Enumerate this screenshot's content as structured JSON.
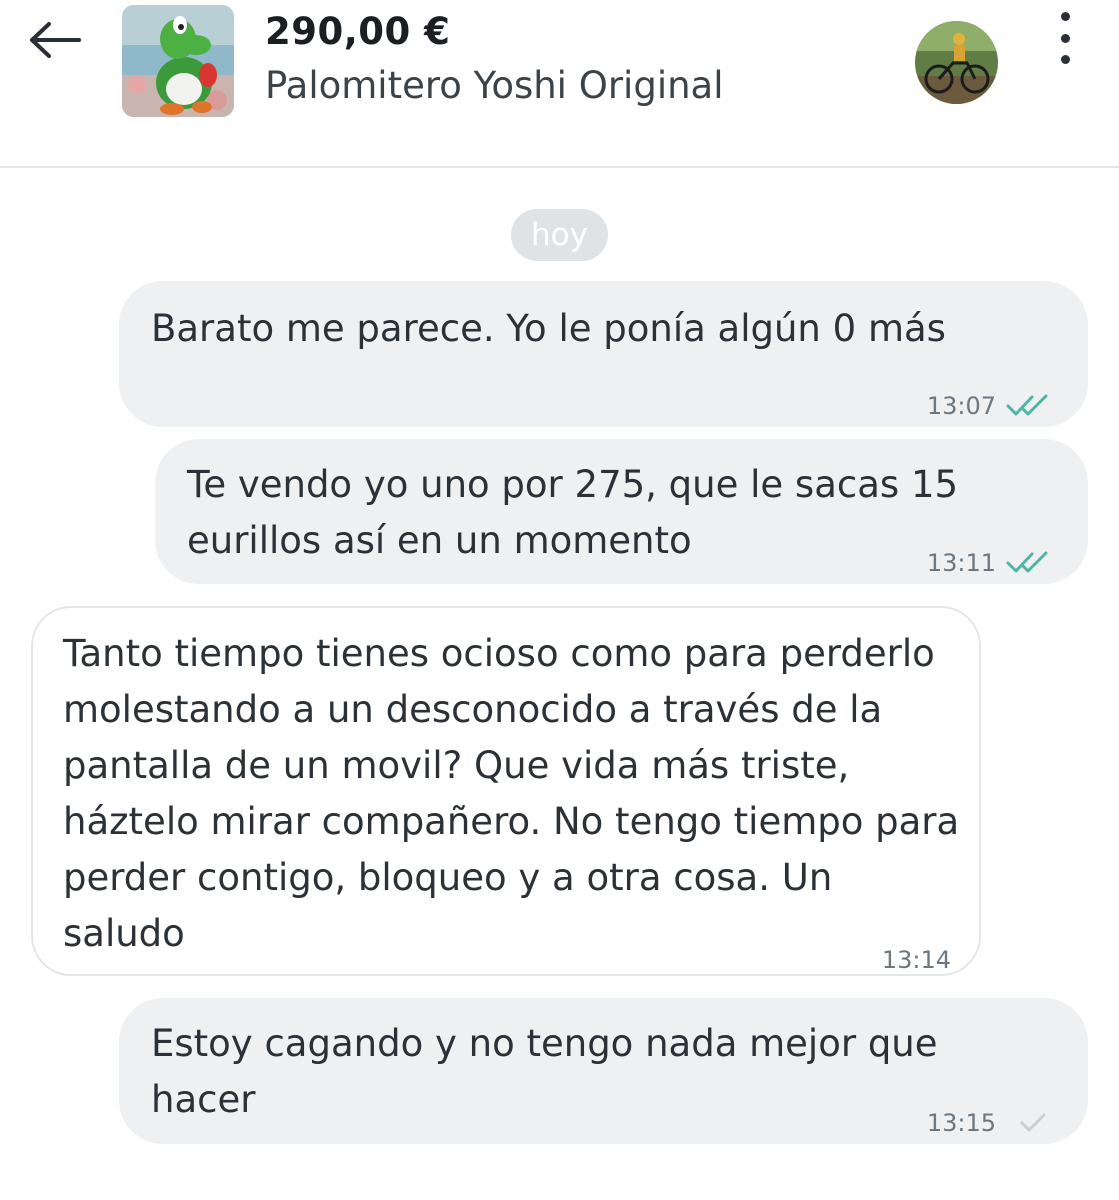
{
  "header": {
    "price": "290,00 €",
    "product_title": "Palomitero Yoshi Original",
    "back_icon": "arrow-left-icon",
    "menu_icon": "more-vertical-icon"
  },
  "date_separator": "hoy",
  "messages": [
    {
      "direction": "outgoing",
      "text": "Barato me parece. Yo le ponía algún 0 más",
      "time": "13:07",
      "status": "read",
      "status_icon": "double-check-icon",
      "status_color": "#4fb6a5"
    },
    {
      "direction": "outgoing",
      "text": "Te vendo yo uno por 275, que le sacas 15 eurillos así en un momento",
      "time": "13:11",
      "status": "read",
      "status_icon": "double-check-icon",
      "status_color": "#4fb6a5"
    },
    {
      "direction": "incoming",
      "text": "Tanto tiempo tienes ocioso como para perderlo molestando a un desconocido a través de la pantalla de un movil? Que vida más triste, háztelo mirar compañero. No tengo tiempo para perder contigo, bloqueo y a otra cosa. Un saludo",
      "time": "13:14"
    },
    {
      "direction": "outgoing",
      "text": "Estoy cagando y no tengo nada mejor que hacer",
      "time": "13:15",
      "status": "sent",
      "status_icon": "single-check-icon",
      "status_color": "#c8ced3"
    }
  ],
  "colors": {
    "outgoing_bubble": "#eef0f2",
    "incoming_bubble": "#ffffff",
    "date_chip": "#dfe3e6"
  }
}
